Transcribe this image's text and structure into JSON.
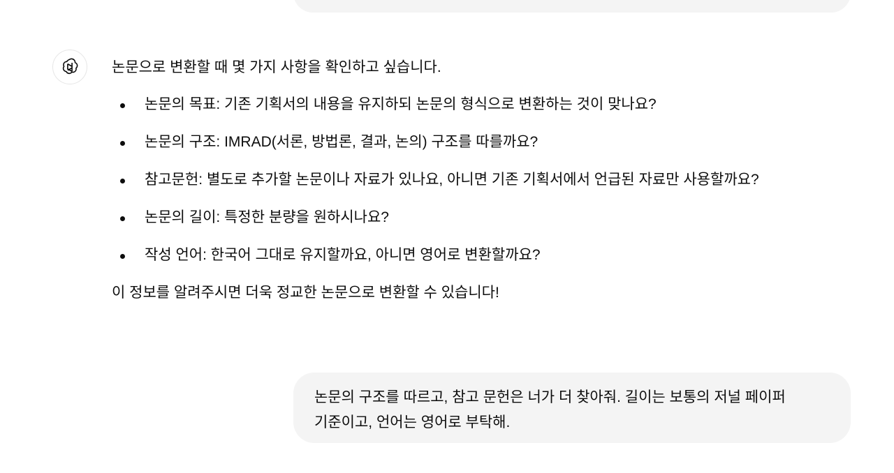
{
  "assistant": {
    "intro": "논문으로 변환할 때 몇 가지 사항을 확인하고 싶습니다.",
    "items": [
      "논문의 목표: 기존 기획서의 내용을 유지하되 논문의 형식으로 변환하는 것이 맞나요?",
      "논문의 구조: IMRAD(서론, 방법론, 결과, 논의) 구조를 따를까요?",
      "참고문헌: 별도로 추가할 논문이나 자료가 있나요, 아니면 기존 기획서에서 언급된 자료만 사용할까요?",
      "논문의 길이: 특정한 분량을 원하시나요?",
      "작성 언어: 한국어 그대로 유지할까요, 아니면 영어로 변환할까요?"
    ],
    "outro": "이 정보를 알려주시면 더욱 정교한 논문으로 변환할 수 있습니다!"
  },
  "user": {
    "line1": "논문의 구조를 따르고, 참고 문헌은 너가 더 찾아줘. 길이는 보통의 저널 페이퍼",
    "line2": "기준이고, 언어는 영어로 부탁해."
  },
  "icons": {
    "assistant_avatar": "openai-logo-icon"
  }
}
